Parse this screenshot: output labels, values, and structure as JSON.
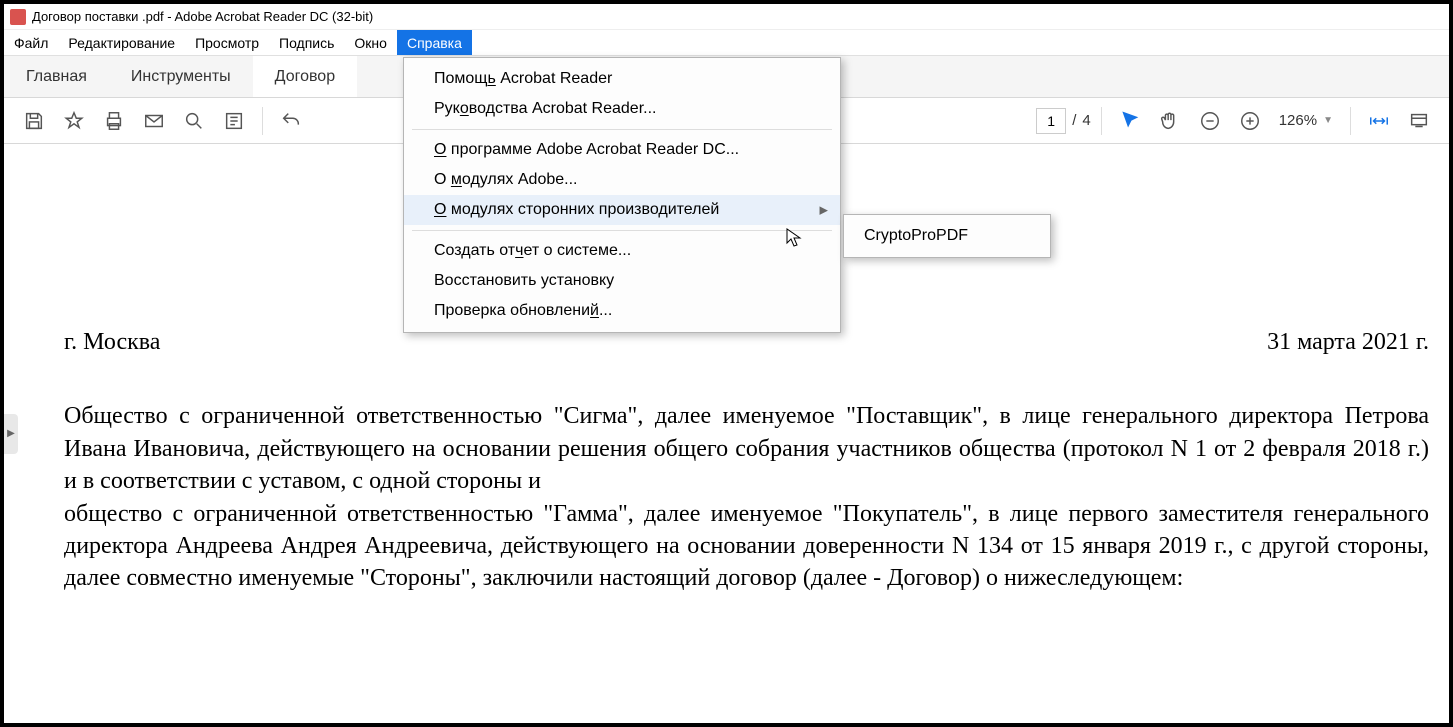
{
  "titlebar": {
    "icon_label": "PDF",
    "title": "Договор поставки .pdf - Adobe Acrobat Reader DC (32-bit)"
  },
  "menubar": {
    "file": "Файл",
    "edit": "Редактирование",
    "view": "Просмотр",
    "sign": "Подпись",
    "window": "Окно",
    "help": "Справка"
  },
  "tabs": {
    "home": "Главная",
    "tools": "Инструменты",
    "doc": "Договор "
  },
  "toolbar": {
    "page_current": "1",
    "page_sep": "/",
    "page_total": "4",
    "zoom": "126%"
  },
  "help_menu": {
    "help": "Помощь Acrobat Reader",
    "help_u": "ь",
    "guides": "Руководства Acrobat Reader...",
    "guides_u": "о",
    "about": "О программе Adobe Acrobat Reader DC...",
    "about_u": "О",
    "adobe_plugins": "О модулях Adobe...",
    "adobe_plugins_u": "м",
    "third_party": "О модулях сторонних производителей",
    "third_party_u": "О",
    "report": "Создать отчет о системе...",
    "report_u": "ч",
    "restore": "Восстановить установку",
    "updates": "Проверка обновлений...",
    "updates_u": "й"
  },
  "submenu": {
    "cryptopro": "CryptoProPDF"
  },
  "document": {
    "city": "г. Москва",
    "date": "31 марта 2021 г.",
    "para1": "Общество с ограниченной ответственностью \"Сигма\", далее именуемое \"Поставщик\", в лице генерального директора Петрова Ивана Ивановича, действующего на основании решения общего собрания участников общества (протокол N 1 от 2 февраля 2018 г.) и в соответствии с уставом, с одной стороны и",
    "para2": "общество с ограниченной ответственностью \"Гамма\", далее именуемое \"Покупатель\", в лице первого заместителя генерального директора Андреева Андрея Андреевича, действующего на основании доверенности N 134 от 15 января 2019 г., с другой стороны, далее совместно именуемые \"Стороны\", заключили настоящий договор (далее - Договор) о нижеследующем:"
  }
}
